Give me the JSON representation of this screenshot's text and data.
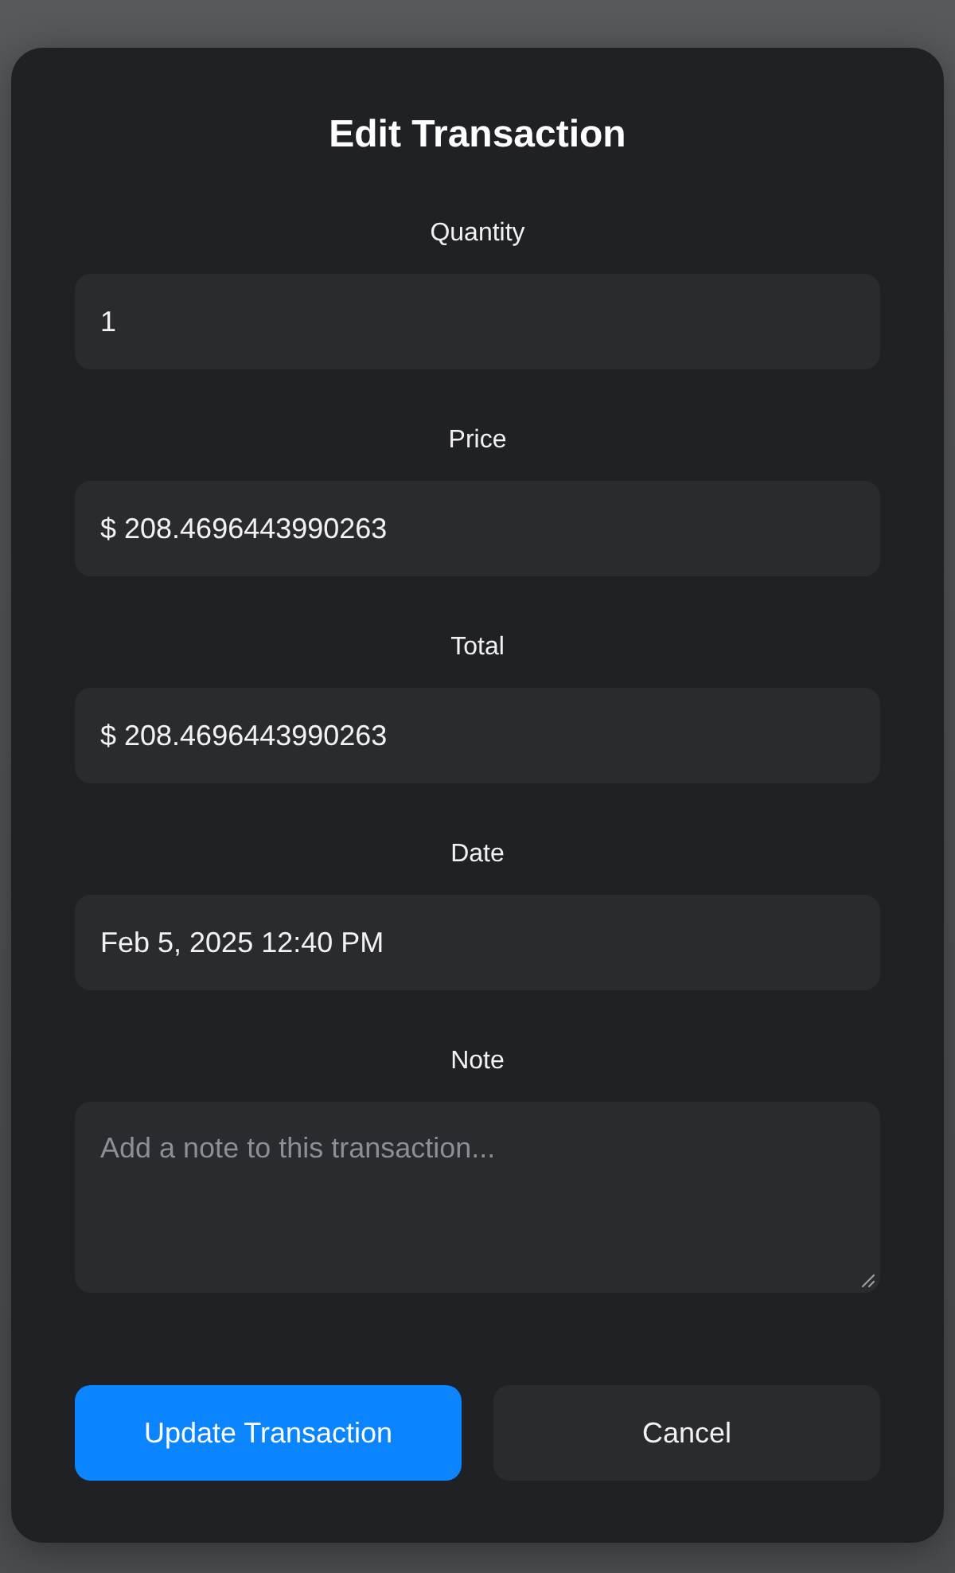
{
  "dialog": {
    "title": "Edit Transaction"
  },
  "fields": [
    {
      "label": "Quantity",
      "kind": "input",
      "value": "1"
    },
    {
      "label": "Price",
      "kind": "input",
      "value": "$ 208.4696443990263"
    },
    {
      "label": "Total",
      "kind": "input",
      "value": "$ 208.4696443990263"
    },
    {
      "label": "Date",
      "kind": "input",
      "value": "Feb 5, 2025 12:40 PM"
    },
    {
      "label": "Note",
      "kind": "textarea",
      "placeholder": "Add a note to this transaction..."
    }
  ],
  "buttons": [
    {
      "label": "Update Transaction",
      "kind": "primary"
    },
    {
      "label": "Cancel",
      "kind": "secondary"
    }
  ]
}
